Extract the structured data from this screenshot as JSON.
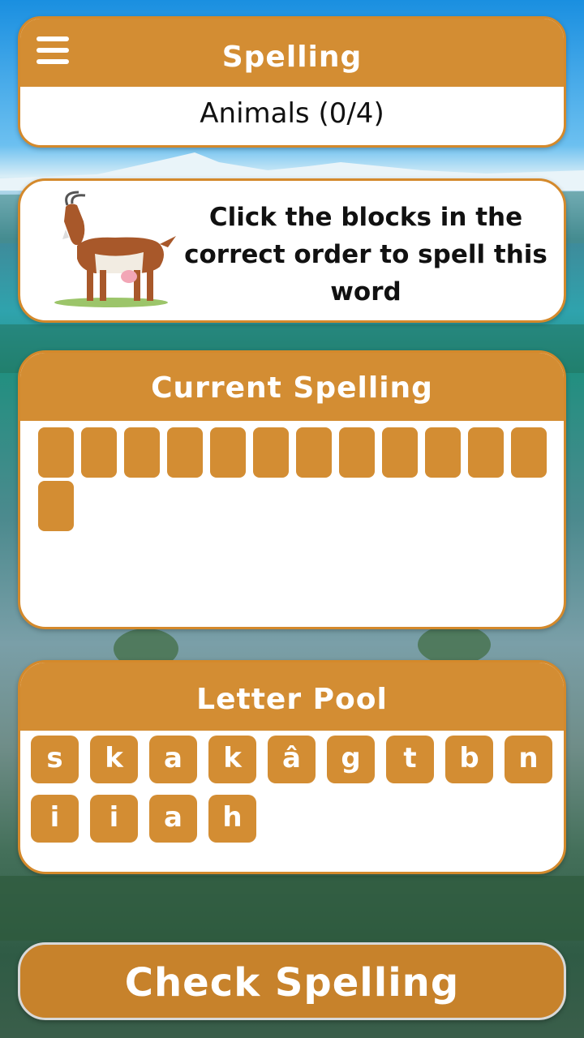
{
  "header": {
    "title": "Spelling",
    "subtitle": "Animals (0/4)",
    "menu_icon": "hamburger-menu-icon"
  },
  "instruction": {
    "text": "Click the blocks in the correct order to spell this word",
    "image": "goat-illustration"
  },
  "current_spelling": {
    "title": "Current Spelling",
    "slot_count": 13
  },
  "letter_pool": {
    "title": "Letter Pool",
    "letters": [
      "s",
      "k",
      "a",
      "k",
      "â",
      "g",
      "t",
      "b",
      "n",
      "i",
      "i",
      "a",
      "h"
    ]
  },
  "check_button": {
    "label": "Check Spelling"
  },
  "colors": {
    "accent": "#d38d33",
    "button": "#c7822b",
    "card": "#ffffff"
  }
}
